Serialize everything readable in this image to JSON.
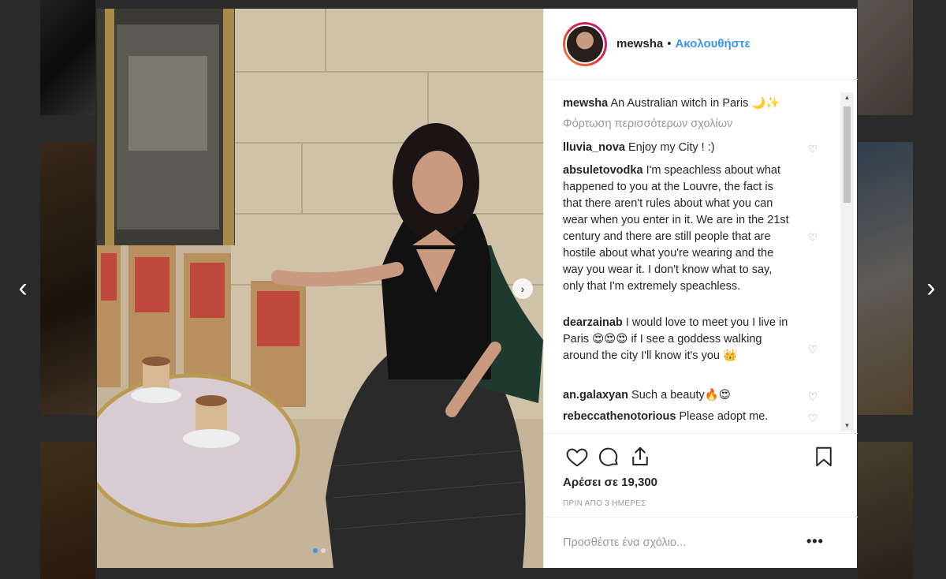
{
  "post": {
    "username": "mewsha",
    "separator": "•",
    "follow_label": "Ακολουθήστε",
    "caption_user": "mewsha",
    "caption_text": "An Australian witch in Paris 🌙✨",
    "load_more_label": "Φόρτωση περισσότερων σχολίων",
    "likes_label": "Αρέσει σε 19,300",
    "time_label": "ΠΡΙΝ ΑΠΟ 3 ΗΜΕΡΕΣ",
    "add_comment_placeholder": "Προσθέστε ένα σχόλιο...",
    "more_label": "•••"
  },
  "comments": [
    {
      "user": "lluvia_nova",
      "text": "Enjoy my City ! :)"
    },
    {
      "user": "absuletovodka",
      "text": "I'm speachless about what happened to you at the Louvre, the fact is that there aren't rules about what you can wear when you enter in it. We are in the 21st century and there are still people that are hostile about what you're wearing and the way you wear it. I don't know what to say, only that I'm extremely speachless."
    },
    {
      "user": "dearzainab",
      "text": "I would love to meet you I live in Paris 😍😍😍 if I see a goddess walking around the city I'll know it's you 👑"
    },
    {
      "user": "an.galaxyan",
      "text": "Such a beauty🔥😍"
    },
    {
      "user": "rebeccathenotorious",
      "text": "Please adopt me."
    }
  ],
  "nav": {
    "prev": "‹",
    "next": "›",
    "photo_next": "›"
  },
  "icons": {
    "heart": "heart-icon",
    "comment": "comment-icon",
    "share": "share-icon",
    "bookmark": "bookmark-icon"
  },
  "colors": {
    "accent": "#3897f0",
    "text": "#262626",
    "muted": "#999999"
  }
}
